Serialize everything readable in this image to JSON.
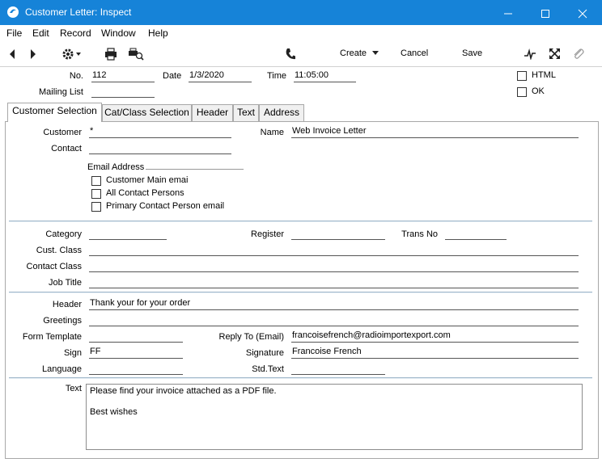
{
  "window": {
    "title": "Customer Letter: Inspect",
    "title_bar_color": "#1683d8"
  },
  "menu": [
    "File",
    "Edit",
    "Record",
    "Window",
    "Help"
  ],
  "toolbar": {
    "create_label": "Create",
    "cancel_label": "Cancel",
    "save_label": "Save"
  },
  "header": {
    "no_label": "No.",
    "no_value": "112",
    "date_label": "Date",
    "date_value": "1/3/2020",
    "time_label": "Time",
    "time_value": "11:05:00",
    "mailing_list_label": "Mailing List",
    "mailing_list_value": "",
    "html_label": "HTML",
    "html_checked": false,
    "ok_label": "OK",
    "ok_checked": false
  },
  "tabs": [
    {
      "label": "Customer Selection",
      "active": true
    },
    {
      "label": "Cat/Class Selection",
      "active": false
    },
    {
      "label": "Header",
      "active": false
    },
    {
      "label": "Text",
      "active": false
    },
    {
      "label": "Address",
      "active": false
    }
  ],
  "selection": {
    "customer_label": "Customer",
    "customer_value": "*",
    "name_label": "Name",
    "name_value": "Web Invoice Letter",
    "contact_label": "Contact",
    "contact_value": "",
    "email_address_label": "Email Address",
    "email_options": [
      {
        "label": "Customer Main emai",
        "checked": false
      },
      {
        "label": "All Contact Persons",
        "checked": false
      },
      {
        "label": "Primary Contact Person email",
        "checked": false
      }
    ]
  },
  "classification": {
    "category_label": "Category",
    "category_value": "",
    "register_label": "Register",
    "register_value": "",
    "trans_no_label": "Trans No",
    "trans_no_value": "",
    "cust_class_label": "Cust. Class",
    "cust_class_value": "",
    "contact_class_label": "Contact Class",
    "contact_class_value": "",
    "job_title_label": "Job Title",
    "job_title_value": ""
  },
  "letter": {
    "header_label": "Header",
    "header_value": "Thank your for your order",
    "greetings_label": "Greetings",
    "greetings_value": "",
    "form_template_label": "Form Template",
    "form_template_value": "",
    "reply_to_label": "Reply To (Email)",
    "reply_to_value": "francoisefrench@radioimportexport.com",
    "sign_label": "Sign",
    "sign_value": "FF",
    "signature_label": "Signature",
    "signature_value": "Francoise French",
    "language_label": "Language",
    "language_value": "",
    "std_text_label": "Std.Text",
    "std_text_value": "",
    "text_label": "Text",
    "text_value": "Please find your invoice attached as a PDF file.\n\nBest wishes"
  }
}
